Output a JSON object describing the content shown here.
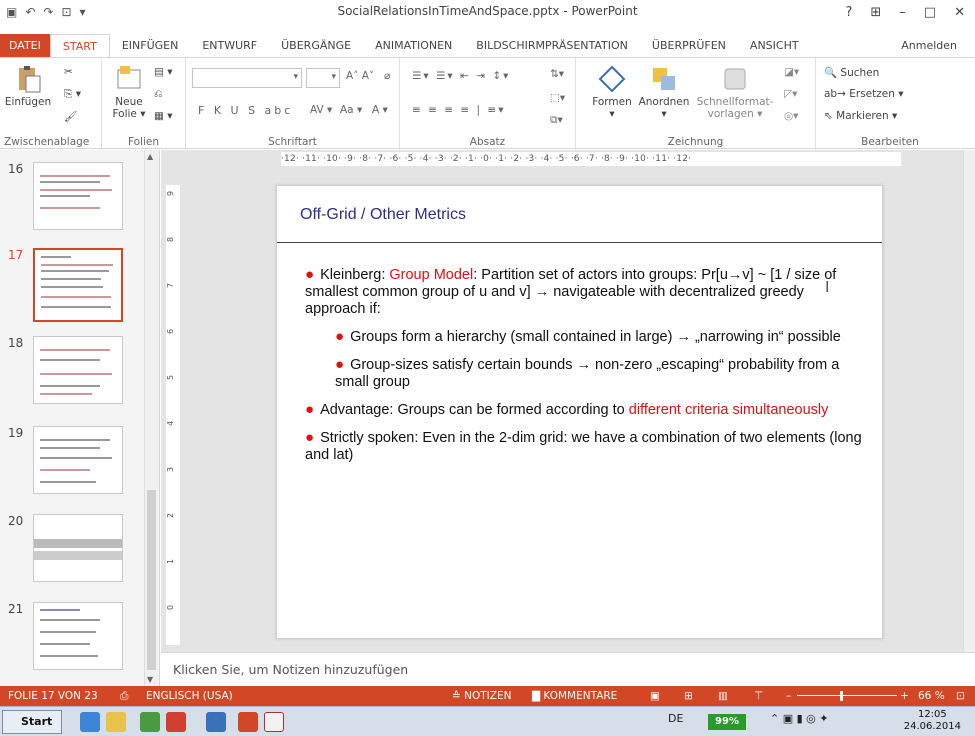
{
  "window": {
    "title": "SocialRelationsInTimeAndSpace.pptx - PowerPoint",
    "help": "?",
    "minimize": "–",
    "maximize": "□",
    "close": "✕"
  },
  "tabs": [
    "DATEI",
    "START",
    "EINFÜGEN",
    "ENTWURF",
    "ÜBERGÄNGE",
    "ANIMATIONEN",
    "BILDSCHIRMPRÄSENTATION",
    "ÜBERPRÜFEN",
    "ANSICHT"
  ],
  "signin": "Anmelden",
  "ribbon": {
    "clipboard": {
      "paste": "Einfügen",
      "label": "Zwischenablage"
    },
    "slides": {
      "new_slide_1": "Neue",
      "new_slide_2": "Folie",
      "label": "Folien"
    },
    "font": {
      "label": "Schriftart",
      "format_buttons": "F  K  U  S  abc",
      "font_size_label": "Aa"
    },
    "paragraph": {
      "label": "Absatz"
    },
    "drawing": {
      "shapes": "Formen",
      "arrange": "Anordnen",
      "quickstyles_1": "Schnellformat-",
      "quickstyles_2": "vorlagen",
      "label": "Zeichnung"
    },
    "editing": {
      "find": "Suchen",
      "replace": "Ersetzen",
      "select": "Markieren",
      "label": "Bearbeiten"
    }
  },
  "thumbnails": [
    {
      "num": "16"
    },
    {
      "num": "17"
    },
    {
      "num": "18"
    },
    {
      "num": "19"
    },
    {
      "num": "20"
    },
    {
      "num": "21"
    }
  ],
  "ruler": "·12· ·11· ·10· ·9· ·8· ·7· ·6· ·5· ·4· ·3· ·2· ·1· ·0· ·1· ·2· ·3· ·4· ·5· ·6· ·7· ·8· ·9· ·10· ·11· ·12·",
  "slide": {
    "title": "Off-Grid / Other Metrics",
    "b1_pre": "Kleinberg: ",
    "b1_red": "Group Model",
    "b1_post": ": Partition set of actors into groups: Pr[u→v] ~ [1 / size of smallest common group of u and v]  → navigateable with decentralized greedy approach  if:",
    "b2": "Groups form a hierarchy (small contained in large) → „narrowing in“ possible",
    "b3": "Group-sizes satisfy certain bounds → non-zero „escaping“ probability from a small group",
    "b4_pre": "Advantage: Groups can be formed according to ",
    "b4_red": "different criteria simultaneously",
    "b5": "Strictly spoken: Even in the 2-dim grid: we have a combination of two elements (long and lat)"
  },
  "notes_placeholder": "Klicken Sie, um Notizen hinzuzufügen",
  "status": {
    "slide_info": "FOLIE 17 VON 23",
    "language": "ENGLISCH (USA)",
    "notes": "≙ NOTIZEN",
    "comments": "KOMMENTARE",
    "zoom": "66 %"
  },
  "taskbar": {
    "start": "Start",
    "lang": "DE",
    "battery": "99%",
    "time": "12:05",
    "date": "24.06.2014"
  },
  "colors": {
    "accent": "#d24726",
    "title_blue": "#2e2e8a",
    "bullet_red": "#e01010"
  }
}
